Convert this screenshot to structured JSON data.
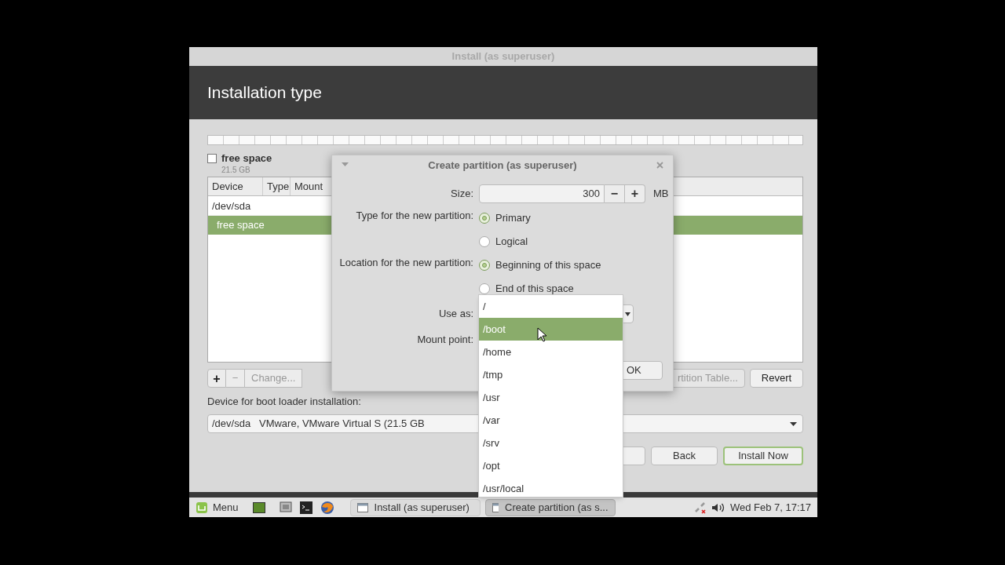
{
  "window": {
    "title": "Install (as superuser)"
  },
  "header": {
    "title": "Installation type"
  },
  "partition_summary": {
    "label": "free space",
    "size": "21.5 GB",
    "checked": false
  },
  "table": {
    "columns": [
      "Device",
      "Type",
      "Mount"
    ],
    "rows": [
      {
        "device": "/dev/sda",
        "selected": false
      },
      {
        "device": "free space",
        "selected": true
      }
    ]
  },
  "partition_buttons": [
    {
      "label": "+",
      "disabled": false
    },
    {
      "label": "−",
      "disabled": true
    },
    {
      "label": "Change...",
      "disabled": true
    }
  ],
  "table_buttons": [
    {
      "label": "rtition Table...",
      "disabled": true
    },
    {
      "label": "Revert",
      "disabled": false
    }
  ],
  "boot_loader": {
    "label": "Device for boot loader installation:",
    "device": "/dev/sda",
    "description": "VMware, VMware Virtual S (21.5 GB"
  },
  "actions": [
    {
      "label": "Back",
      "default": false
    },
    {
      "label": "Install Now",
      "default": true
    }
  ],
  "dialog": {
    "title": "Create partition (as superuser)",
    "size": {
      "label": "Size:",
      "value": "300",
      "minus": "−",
      "plus": "+",
      "unit": "MB"
    },
    "type": {
      "label": "Type for the new partition:",
      "options": [
        {
          "label": "Primary",
          "selected": true
        },
        {
          "label": "Logical",
          "selected": false
        }
      ]
    },
    "location": {
      "label": "Location for the new partition:",
      "options": [
        {
          "label": "Beginning of this space",
          "selected": true
        },
        {
          "label": "End of this space",
          "selected": false
        }
      ]
    },
    "use_as": {
      "label": "Use as:"
    },
    "mount_point": {
      "label": "Mount point:"
    },
    "ok": "OK"
  },
  "dropdown": {
    "items": [
      {
        "label": "/",
        "selected": false
      },
      {
        "label": "/boot",
        "selected": true
      },
      {
        "label": "/home",
        "selected": false
      },
      {
        "label": "/tmp",
        "selected": false
      },
      {
        "label": "/usr",
        "selected": false
      },
      {
        "label": "/var",
        "selected": false
      },
      {
        "label": "/srv",
        "selected": false
      },
      {
        "label": "/opt",
        "selected": false
      },
      {
        "label": "/usr/local",
        "selected": false
      }
    ]
  },
  "taskbar": {
    "menu": "Menu",
    "windows": [
      {
        "label": "Install (as superuser)",
        "selected": false
      },
      {
        "label": "Create partition (as s...",
        "selected": true
      }
    ],
    "clock": "Wed Feb 7, 17:17"
  }
}
